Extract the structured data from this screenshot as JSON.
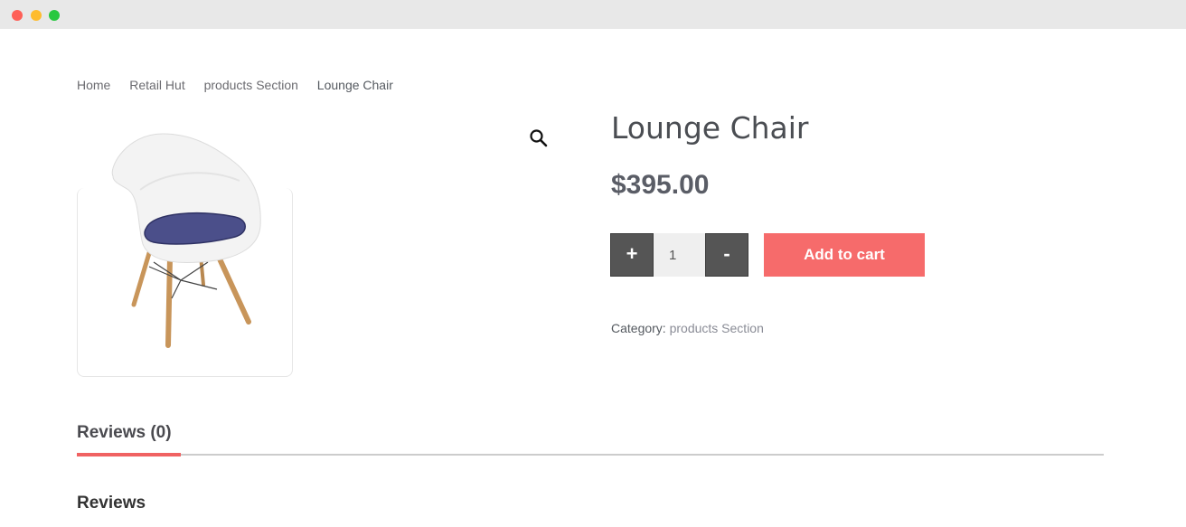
{
  "breadcrumb": [
    "Home",
    "Retail Hut",
    "products Section",
    "Lounge Chair"
  ],
  "product": {
    "title": "Lounge Chair",
    "price": "$395.00",
    "image_icon": "lounge-chair-image"
  },
  "quantity": {
    "plus_label": "+",
    "minus_label": "-",
    "value": "1"
  },
  "cart": {
    "add_label": "Add to cart"
  },
  "category": {
    "label": "Category:",
    "value": "products Section"
  },
  "tabs": [
    {
      "label": "Reviews (0)",
      "active": true
    }
  ],
  "reviews": {
    "heading": "Reviews"
  },
  "icons": {
    "zoom": "magnifier-icon"
  },
  "colors": {
    "accent": "#f66b6b",
    "button_dark": "#555555",
    "tab_active": "#f06262"
  }
}
